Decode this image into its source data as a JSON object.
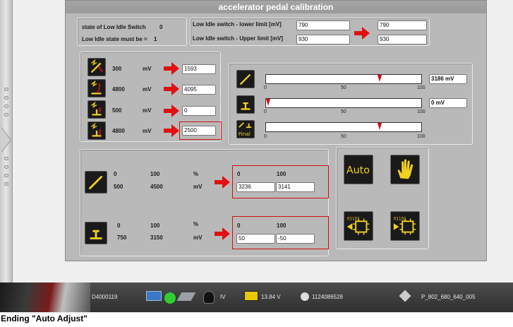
{
  "title": "accelerator pedal calibration",
  "idle": {
    "state_label": "state of Low Idle Switch",
    "state_value": "0",
    "must_label": "Low Idle state must be =",
    "must_value": "1",
    "lower_label": "Low Idle switch - lower limit [mV]",
    "lower_value": "790",
    "lower_result": "790",
    "upper_label": "Low Idle switch - Upper limit [mV]",
    "upper_value": "930",
    "upper_result": "930"
  },
  "params": [
    {
      "value": "300",
      "unit": "mV",
      "field": "1593"
    },
    {
      "value": "4800",
      "unit": "mV",
      "field": "4095"
    },
    {
      "value": "500",
      "unit": "mV",
      "field": "0"
    },
    {
      "value": "4800",
      "unit": "mV",
      "field": "2500"
    }
  ],
  "sliders": [
    {
      "level_fraction": 0.73,
      "scale": [
        "0",
        "50",
        "100"
      ],
      "readout": "3186 mV"
    },
    {
      "level_fraction": 0.0,
      "scale": [
        "0",
        "50",
        "100"
      ],
      "readout": "0 mV"
    },
    {
      "level_fraction": 0.73,
      "scale": [
        "0",
        "50",
        "100"
      ],
      "readout": ""
    }
  ],
  "final_label": "Final",
  "calib": [
    {
      "row1": [
        "0",
        "100",
        "%"
      ],
      "row2": [
        "500",
        "4500",
        "mV"
      ],
      "out_head": [
        "0",
        "100"
      ],
      "out_vals": [
        "3236",
        "3141"
      ]
    },
    {
      "row1": [
        "0",
        "100",
        "%"
      ],
      "row2": [
        "750",
        "3150",
        "mV"
      ],
      "out_head": [
        "0",
        "100"
      ],
      "out_vals": [
        "50",
        "-50"
      ]
    }
  ],
  "auto_label": "Auto",
  "status": {
    "id": "D4000119",
    "iv": "IV",
    "voltage": "13.84 V",
    "serial": "1124086528",
    "part": "P_802_680_640_005"
  },
  "footer": "Ending \"Auto Adjust\""
}
